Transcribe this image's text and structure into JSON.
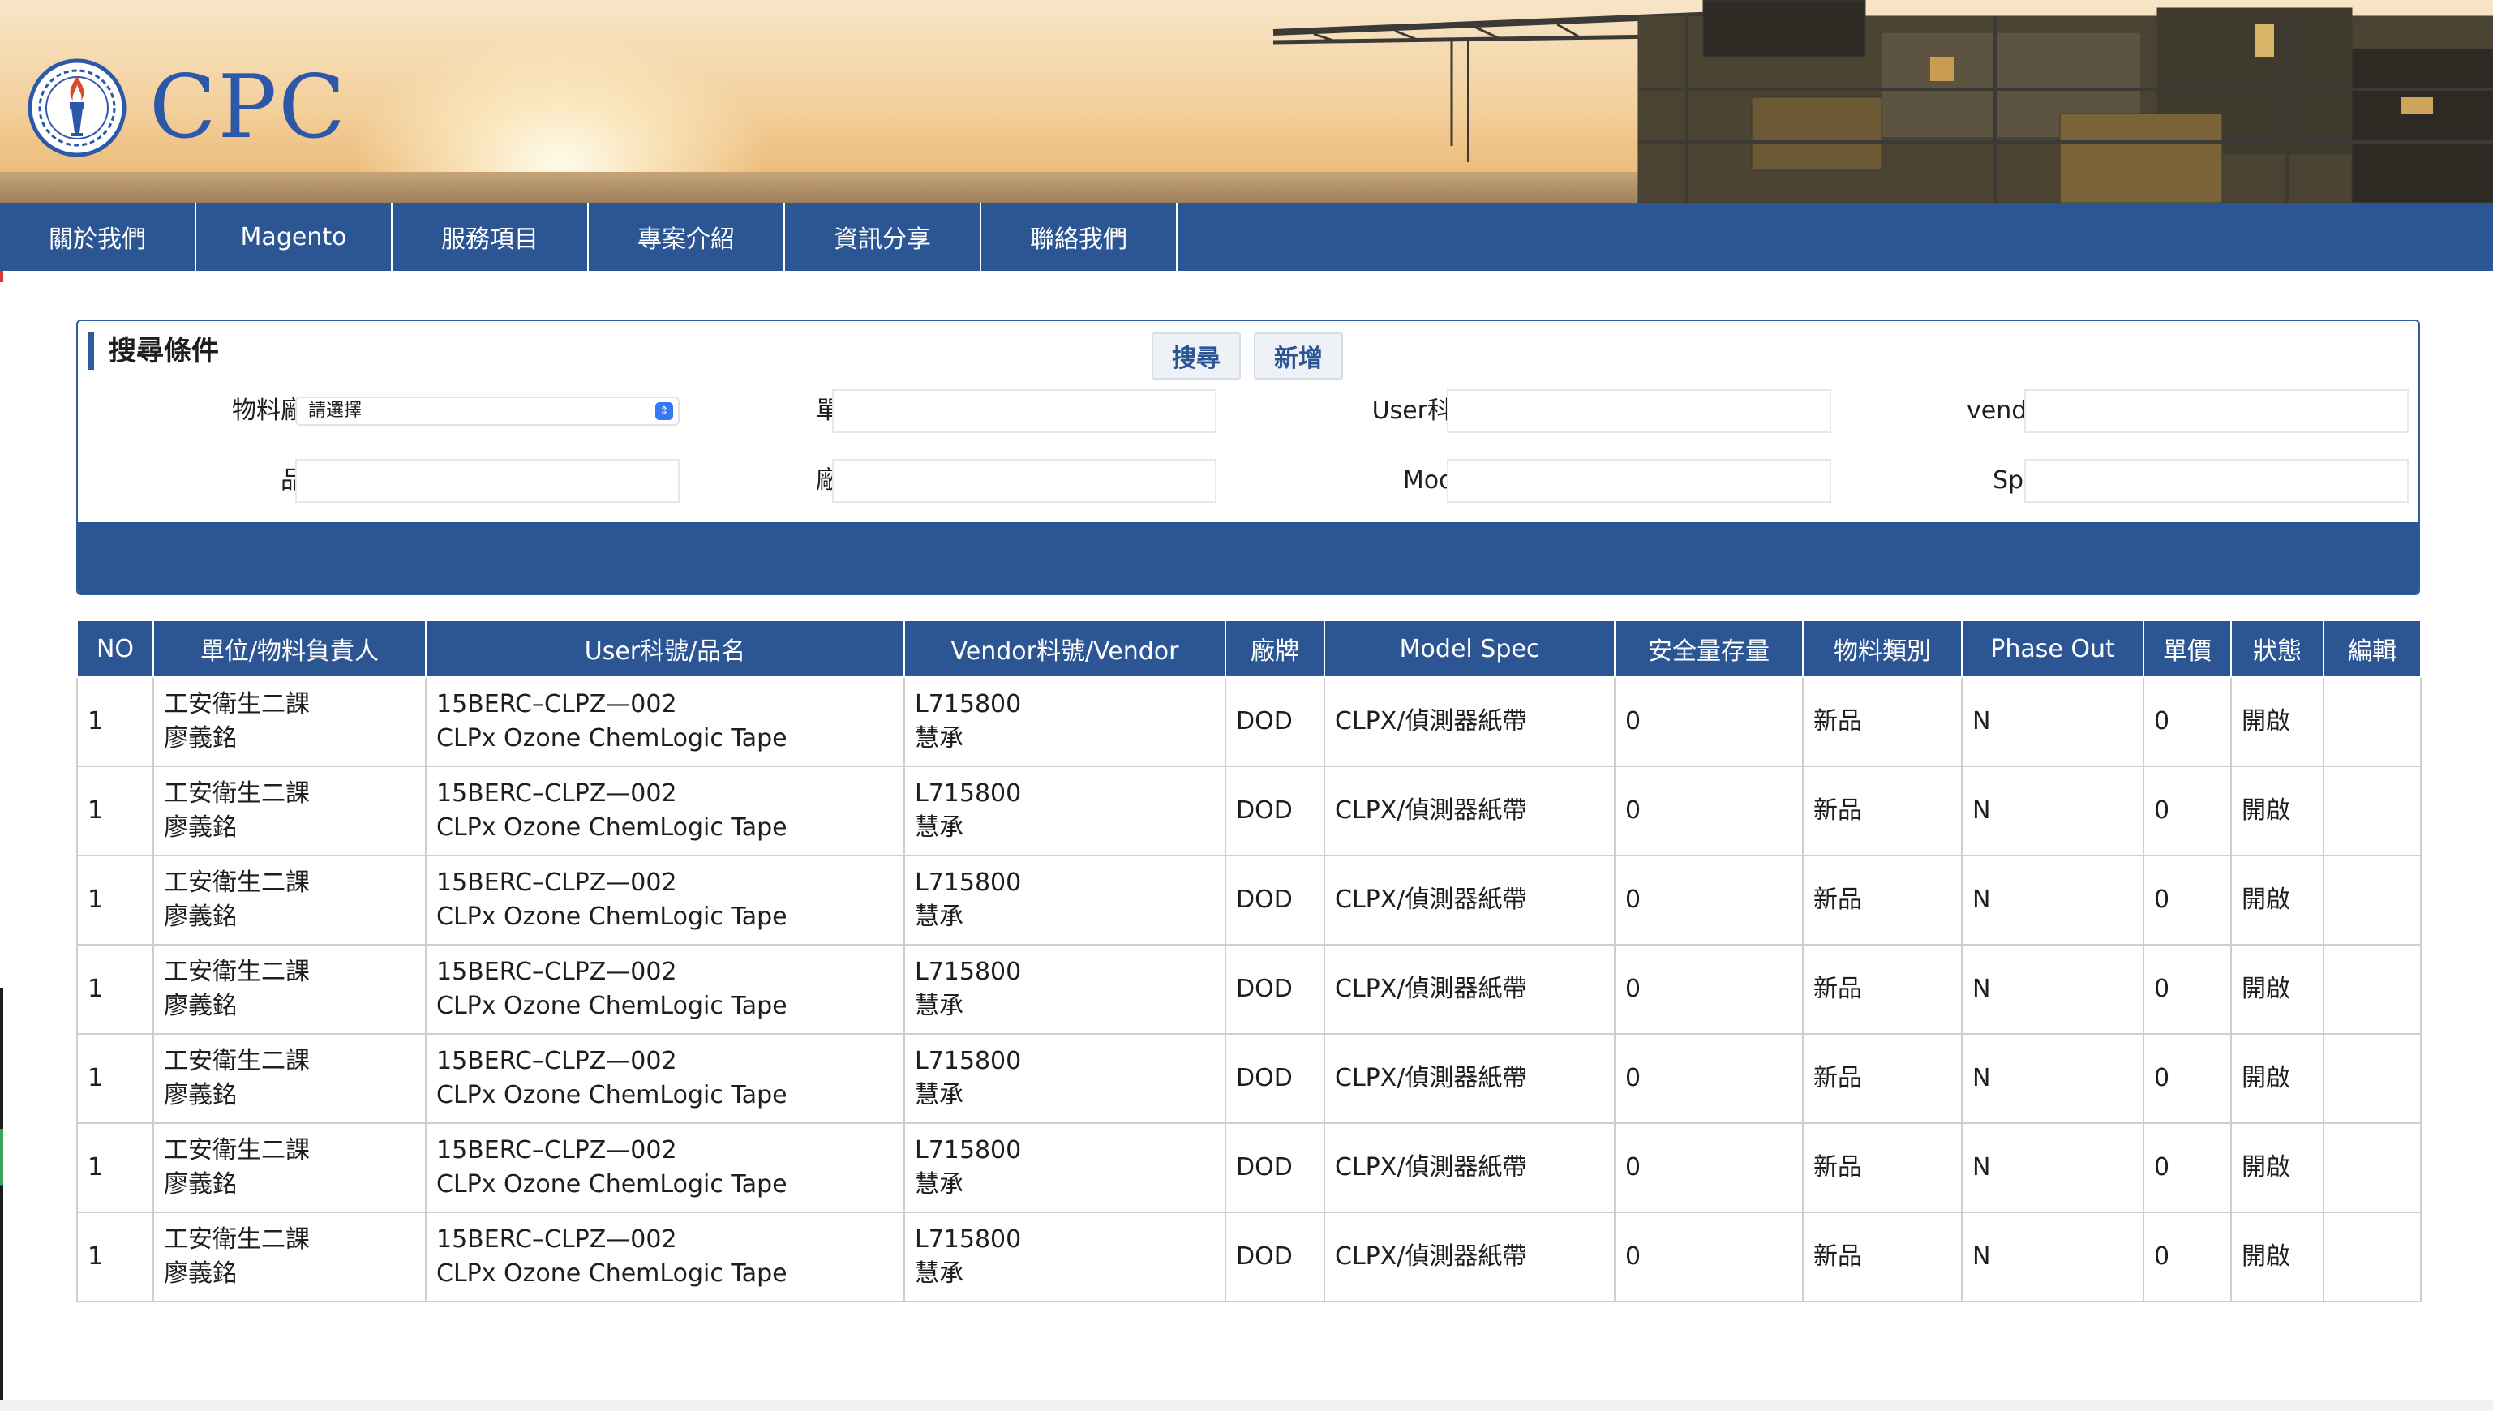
{
  "brand": {
    "logo_text": "CPC"
  },
  "nav": {
    "items": [
      "關於我們",
      "Magento",
      "服務項目",
      "專案介紹",
      "資訊分享",
      "聯絡我們"
    ]
  },
  "search": {
    "title": "搜尋條件",
    "labels": {
      "material_area": "物料廠區：",
      "unit": "單位：",
      "user_part_no": "User科號：",
      "vendor": "vendor：",
      "product_name": "品名：",
      "brand": "廠牌：",
      "model": "Model：",
      "spec": "Spec："
    },
    "select_value": "請選擇",
    "buttons": {
      "search": "搜尋",
      "add": "新增"
    }
  },
  "table": {
    "headers": [
      "NO",
      "單位/物料負責人",
      "User科號/品名",
      "Vendor料號/Vendor",
      "廠牌",
      "Model Spec",
      "安全量存量",
      "物料類別",
      "Phase Out",
      "單價",
      "狀態",
      "編輯"
    ],
    "rows": [
      {
        "no": "1",
        "unit": "工安衛生二課",
        "owner": "廖義銘",
        "user_no": "15BERC–CLPZ—002",
        "name": "CLPx Ozone ChemLogic Tape",
        "vendor_no": "L715800",
        "vendor": "慧承",
        "brand": "DOD",
        "model_spec": "CLPX/偵測器紙帶",
        "safety_stock": "0",
        "category": "新品",
        "phase_out": "N",
        "price": "0",
        "status": "開啟",
        "edit": ""
      },
      {
        "no": "1",
        "unit": "工安衛生二課",
        "owner": "廖義銘",
        "user_no": "15BERC–CLPZ—002",
        "name": "CLPx Ozone ChemLogic Tape",
        "vendor_no": "L715800",
        "vendor": "慧承",
        "brand": "DOD",
        "model_spec": "CLPX/偵測器紙帶",
        "safety_stock": "0",
        "category": "新品",
        "phase_out": "N",
        "price": "0",
        "status": "開啟",
        "edit": ""
      },
      {
        "no": "1",
        "unit": "工安衛生二課",
        "owner": "廖義銘",
        "user_no": "15BERC–CLPZ—002",
        "name": "CLPx Ozone ChemLogic Tape",
        "vendor_no": "L715800",
        "vendor": "慧承",
        "brand": "DOD",
        "model_spec": "CLPX/偵測器紙帶",
        "safety_stock": "0",
        "category": "新品",
        "phase_out": "N",
        "price": "0",
        "status": "開啟",
        "edit": ""
      },
      {
        "no": "1",
        "unit": "工安衛生二課",
        "owner": "廖義銘",
        "user_no": "15BERC–CLPZ—002",
        "name": "CLPx Ozone ChemLogic Tape",
        "vendor_no": "L715800",
        "vendor": "慧承",
        "brand": "DOD",
        "model_spec": "CLPX/偵測器紙帶",
        "safety_stock": "0",
        "category": "新品",
        "phase_out": "N",
        "price": "0",
        "status": "開啟",
        "edit": ""
      },
      {
        "no": "1",
        "unit": "工安衛生二課",
        "owner": "廖義銘",
        "user_no": "15BERC–CLPZ—002",
        "name": "CLPx Ozone ChemLogic Tape",
        "vendor_no": "L715800",
        "vendor": "慧承",
        "brand": "DOD",
        "model_spec": "CLPX/偵測器紙帶",
        "safety_stock": "0",
        "category": "新品",
        "phase_out": "N",
        "price": "0",
        "status": "開啟",
        "edit": ""
      },
      {
        "no": "1",
        "unit": "工安衛生二課",
        "owner": "廖義銘",
        "user_no": "15BERC–CLPZ—002",
        "name": "CLPx Ozone ChemLogic Tape",
        "vendor_no": "L715800",
        "vendor": "慧承",
        "brand": "DOD",
        "model_spec": "CLPX/偵測器紙帶",
        "safety_stock": "0",
        "category": "新品",
        "phase_out": "N",
        "price": "0",
        "status": "開啟",
        "edit": ""
      },
      {
        "no": "1",
        "unit": "工安衛生二課",
        "owner": "廖義銘",
        "user_no": "15BERC–CLPZ—002",
        "name": "CLPx Ozone ChemLogic Tape",
        "vendor_no": "L715800",
        "vendor": "慧承",
        "brand": "DOD",
        "model_spec": "CLPX/偵測器紙帶",
        "safety_stock": "0",
        "category": "新品",
        "phase_out": "N",
        "price": "0",
        "status": "開啟",
        "edit": ""
      }
    ]
  },
  "colors": {
    "brand_blue": "#2c5593",
    "logo_blue": "#2b58a8",
    "panel_border": "#2e5c9b"
  },
  "icons": {
    "logo": "cpc-torch-emblem-icon",
    "select": "select-arrows-icon"
  }
}
